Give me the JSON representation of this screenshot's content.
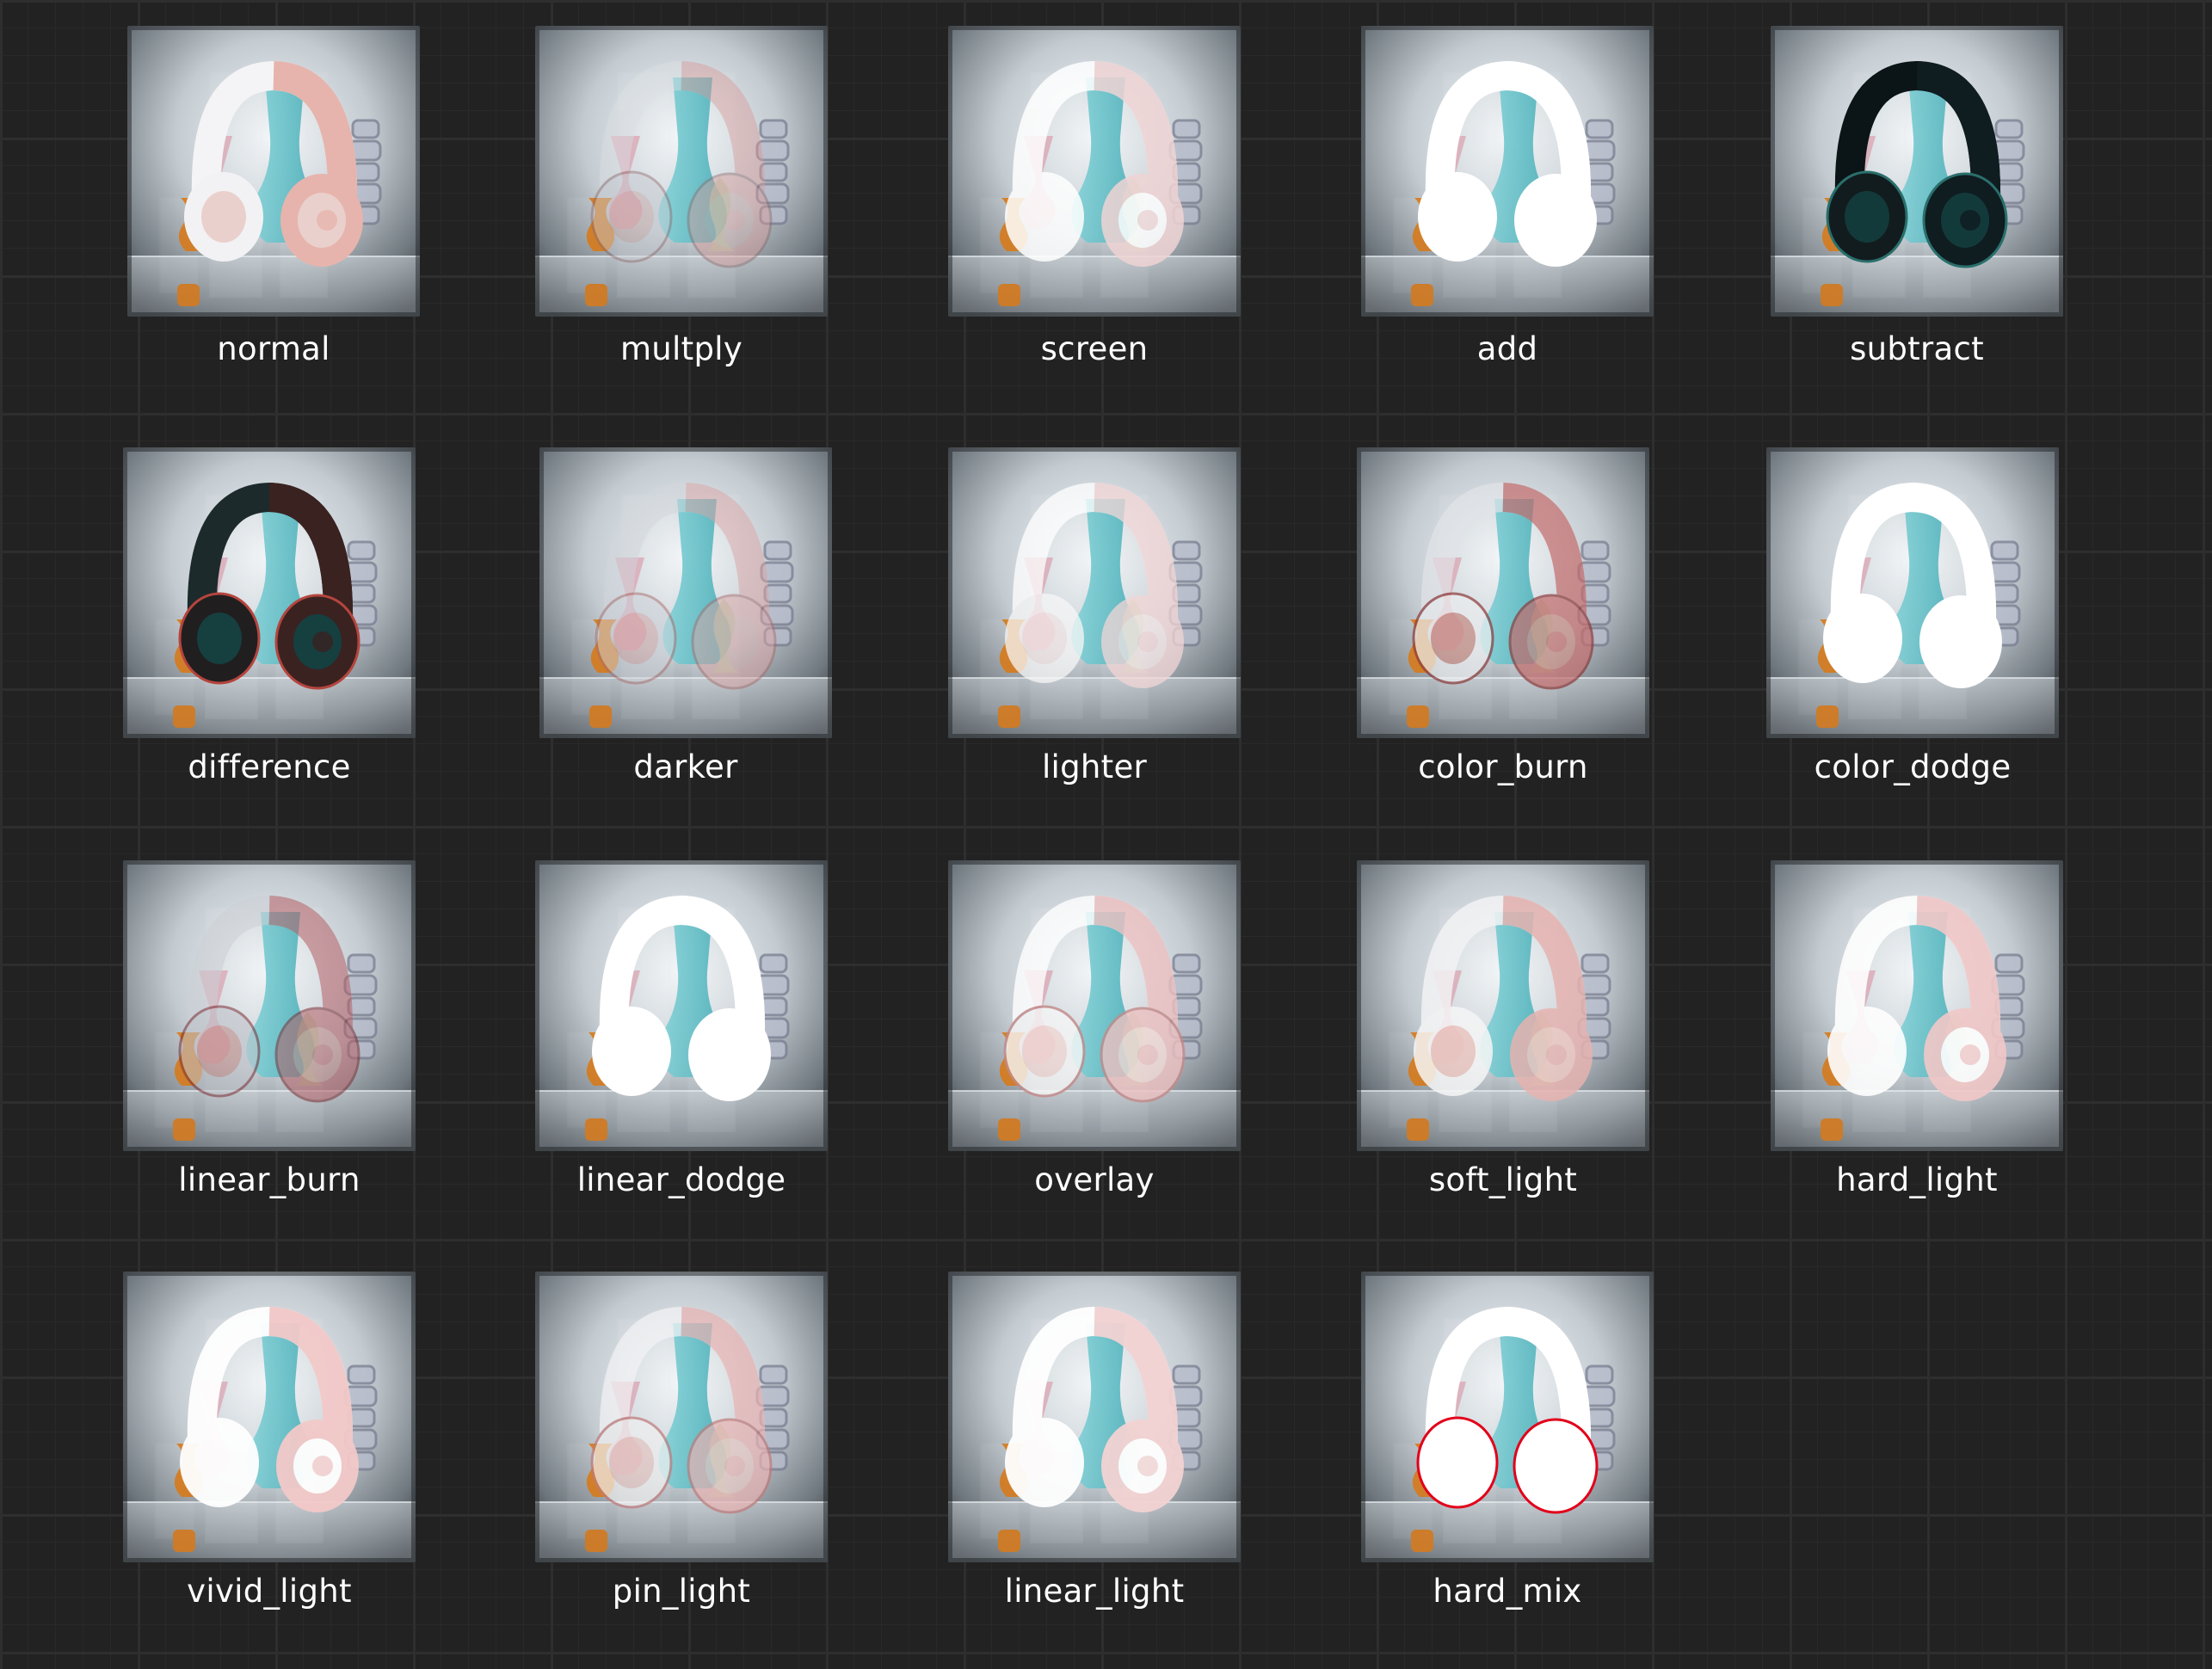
{
  "canvas": {
    "background": "#222222",
    "grid_color": "#2e2e2e"
  },
  "nodes": [
    {
      "label": "normal",
      "mode": "normal"
    },
    {
      "label": "multply",
      "mode": "multiply"
    },
    {
      "label": "screen",
      "mode": "screen"
    },
    {
      "label": "add",
      "mode": "add"
    },
    {
      "label": "subtract",
      "mode": "subtract"
    },
    {
      "label": "difference",
      "mode": "difference"
    },
    {
      "label": "darker",
      "mode": "darker"
    },
    {
      "label": "lighter",
      "mode": "lighter"
    },
    {
      "label": "color_burn",
      "mode": "color_burn"
    },
    {
      "label": "color_dodge",
      "mode": "color_dodge"
    },
    {
      "label": "linear_burn",
      "mode": "linear_burn"
    },
    {
      "label": "linear_dodge",
      "mode": "linear_dodge"
    },
    {
      "label": "overlay",
      "mode": "overlay"
    },
    {
      "label": "soft_light",
      "mode": "soft_light"
    },
    {
      "label": "hard_light",
      "mode": "hard_light"
    },
    {
      "label": "vivid_light",
      "mode": "vivid_light"
    },
    {
      "label": "pin_light",
      "mode": "pin_light"
    },
    {
      "label": "linear_light",
      "mode": "linear_light"
    },
    {
      "label": "hard_mix",
      "mode": "hard_mix"
    }
  ]
}
